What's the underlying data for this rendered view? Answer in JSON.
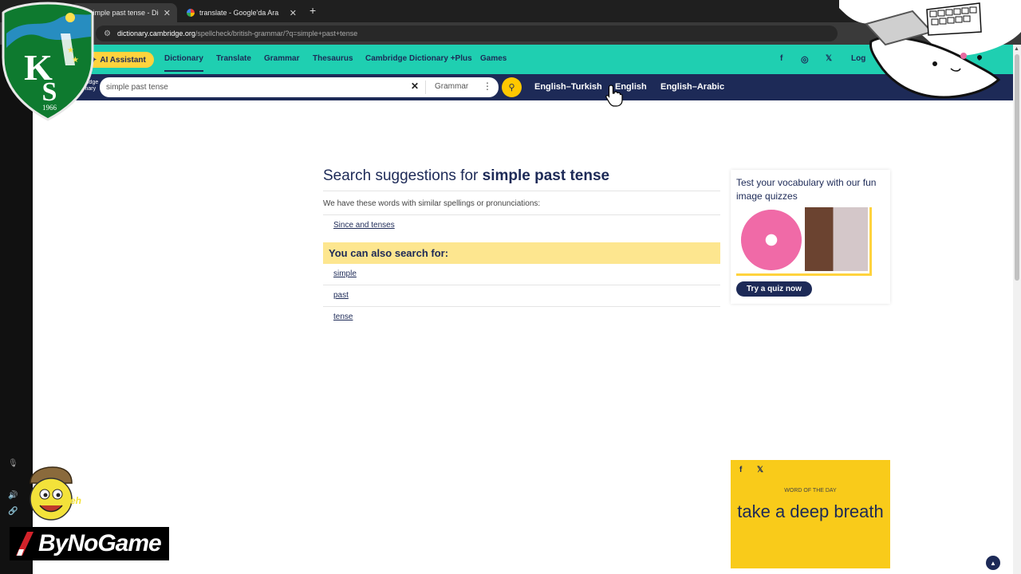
{
  "browser": {
    "tabs": [
      {
        "title": "simple past tense - Did you spell",
        "active": true
      },
      {
        "title": "translate - Google'da Ara",
        "active": false
      }
    ],
    "url_host": "dictionary.cambridge.org",
    "url_path": "/spellcheck/british-grammar/?q=simple+past+tense"
  },
  "nav": {
    "ai_label": "AI Assistant",
    "links": [
      "Dictionary",
      "Translate",
      "Grammar",
      "Thesaurus",
      "Cambridge Dictionary +Plus",
      "Games"
    ],
    "active_link": "Dictionary",
    "login": "Log"
  },
  "search": {
    "brand": "Cambridge Dictionary",
    "value": "simple past tense",
    "dictionary": "Grammar",
    "dict_links": [
      "English–Turkish",
      "English",
      "English–Arabic"
    ]
  },
  "results": {
    "title_prefix": "Search suggestions for",
    "query": "simple past tense",
    "hint": "We have these words with similar spellings or pronunciations:",
    "suggestions": [
      "Since and tenses"
    ],
    "also_heading": "You can also search for:",
    "also_items": [
      "simple",
      "past",
      "tense"
    ]
  },
  "quiz": {
    "text": "Test your vocabulary with our fun image quizzes",
    "button": "Try a quiz now"
  },
  "wotd": {
    "label": "WORD OF THE DAY",
    "word": "take a deep breath"
  },
  "overlays": {
    "club_letters": "KS",
    "club_year": "1966",
    "brand": "ByNoGame"
  },
  "colors": {
    "teal": "#1fcfb1",
    "navy": "#1d2a57",
    "yellow": "#ffd33d",
    "highlight": "#fde68f",
    "club_green": "#0e7a2f"
  }
}
